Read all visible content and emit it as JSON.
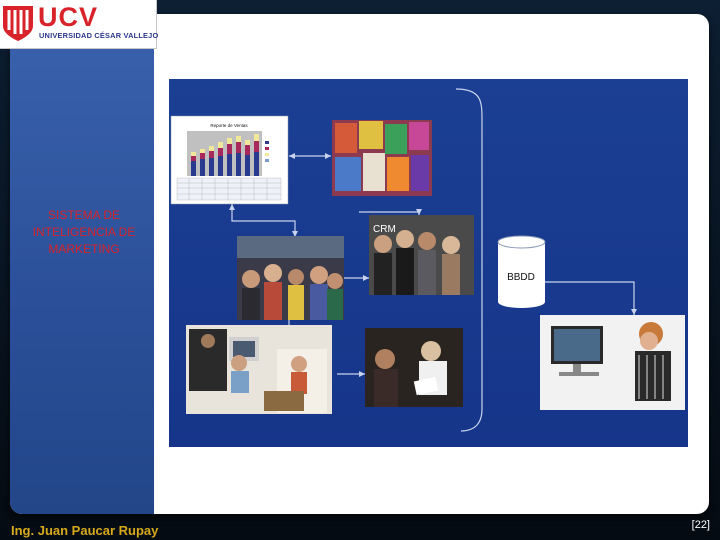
{
  "logo": {
    "name": "UCV",
    "subtitle": "UNIVERSIDAD CÉSAR VALLEJO"
  },
  "sidebar": {
    "title": "SISTEMA DE INTELIGENCIA DE MARKETING"
  },
  "diagram": {
    "chart_thumb_title": "Reporte de Ventas",
    "crm_label": "CRM",
    "database_label": "BBDD"
  },
  "footer": {
    "author": "Ing. Juan Paucar Rupay",
    "page": "[22]"
  },
  "colors": {
    "sidebar": "#2a4f98",
    "diagram_background": "#1b3f93",
    "title_red": "#d8232a",
    "footer_gold": "#d6a91c"
  }
}
